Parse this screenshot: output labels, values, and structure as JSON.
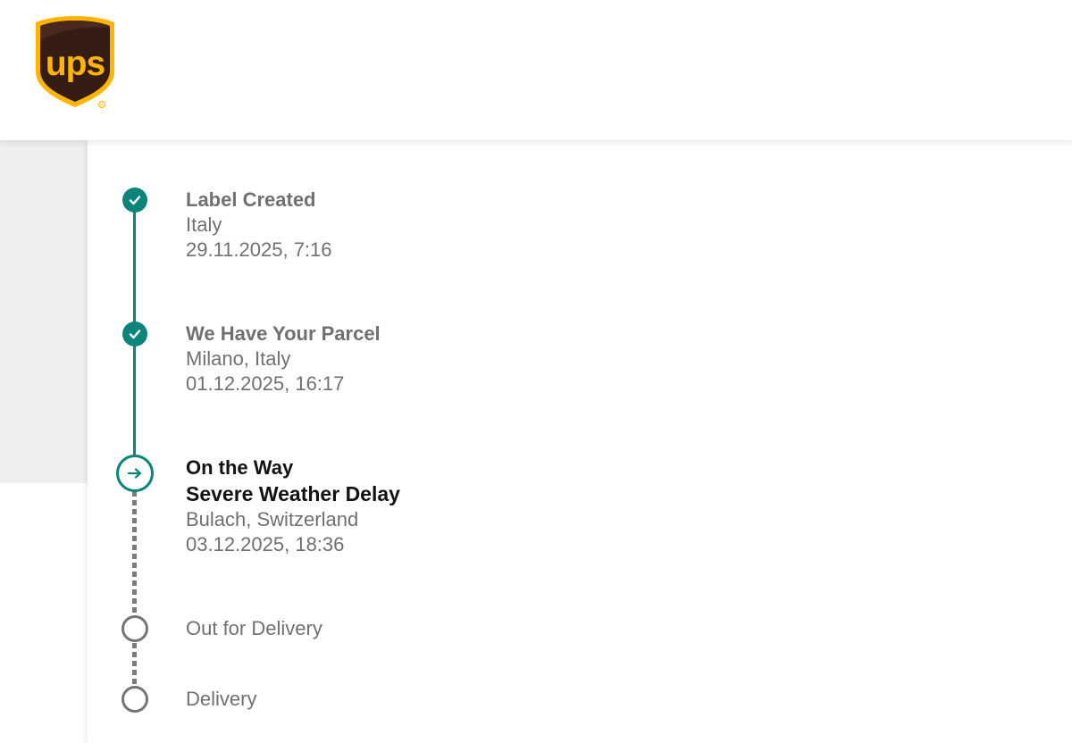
{
  "header": {
    "logo_text": "ups",
    "logo_icon": "ups-shield-logo"
  },
  "timeline": {
    "steps": [
      {
        "status": "complete",
        "title": "Label Created",
        "location": "Italy",
        "datetime": "29.11.2025, 7:16",
        "icon": "check-icon"
      },
      {
        "status": "complete",
        "title": "We Have Your Parcel",
        "location": "Milano, Italy",
        "datetime": "01.12.2025, 16:17",
        "icon": "check-icon"
      },
      {
        "status": "current",
        "title": "On the Way",
        "subtitle": "Severe Weather Delay",
        "location": "Bulach, Switzerland",
        "datetime": "03.12.2025, 18:36",
        "icon": "arrow-right-icon"
      },
      {
        "status": "pending",
        "title": "Out for Delivery",
        "icon": "empty-circle-icon"
      },
      {
        "status": "pending",
        "title": "Delivery",
        "icon": "empty-circle-icon"
      }
    ]
  },
  "colors": {
    "logo_brown": "#351c15",
    "logo_gold": "#ffb500",
    "progress_teal": "#0b847a",
    "pending_gray": "#757575",
    "side_panel": "#efefef"
  }
}
